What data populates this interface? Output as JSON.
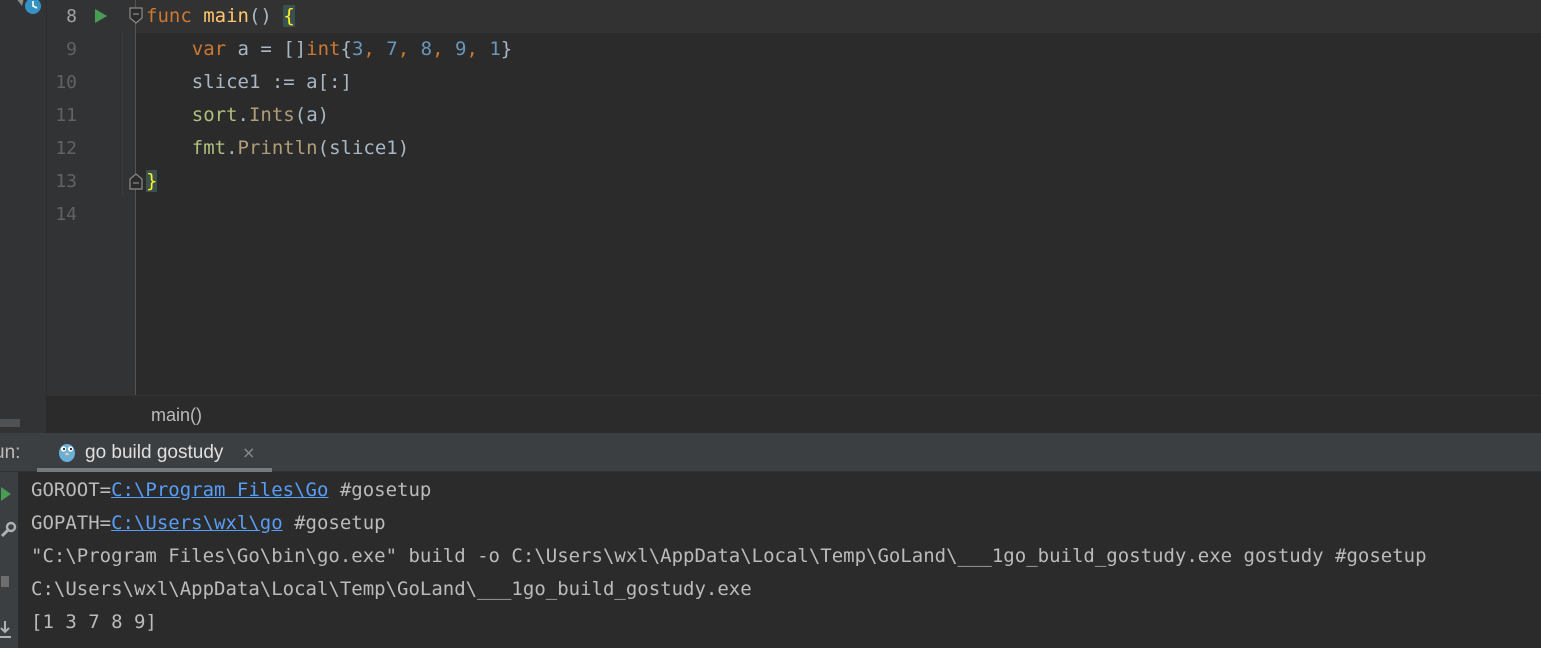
{
  "editor": {
    "line_numbers": [
      "8",
      "9",
      "10",
      "11",
      "12",
      "13",
      "14"
    ],
    "code": {
      "l8": {
        "kw_func": "func",
        "fn_name": "main",
        "parens": "() ",
        "brace": "{"
      },
      "l9": {
        "kw_var": "var",
        "assign": " a = []",
        "kw_int": "int",
        "open": "{",
        "n1": "3",
        "c1": ", ",
        "n2": "7",
        "c2": ", ",
        "n3": "8",
        "c3": ", ",
        "n4": "9",
        "c4": ", ",
        "n5": "1",
        "close": "}"
      },
      "l10": {
        "text": "slice1 := a[:]"
      },
      "l11": {
        "pkg": "sort",
        "dot": ".",
        "call": "Ints",
        "args": "(a)"
      },
      "l12": {
        "pkg": "fmt",
        "dot": ".",
        "call": "Println",
        "args": "(slice1)"
      },
      "l13": {
        "brace": "}"
      }
    },
    "breadcrumb": "main()"
  },
  "run_panel": {
    "label": "un:",
    "tab_label": "go build gostudy",
    "tab_close": "×",
    "console": {
      "l1": {
        "prefix": "GOROOT=",
        "link": "C:\\Program Files\\Go",
        "suffix": " #gosetup"
      },
      "l2": {
        "prefix": "GOPATH=",
        "link": "C:\\Users\\wxl\\go",
        "suffix": " #gosetup"
      },
      "l3": "\"C:\\Program Files\\Go\\bin\\go.exe\" build -o C:\\Users\\wxl\\AppData\\Local\\Temp\\GoLand\\___1go_build_gostudy.exe gostudy #gosetup",
      "l4": "C:\\Users\\wxl\\AppData\\Local\\Temp\\GoLand\\___1go_build_gostudy.exe",
      "l5": "[1 3 7 8 9]"
    }
  },
  "icons": [
    "tool-clock-icon",
    "run-gutter-icon",
    "fold-icon",
    "gopher-icon",
    "rerun-icon",
    "wrench-icon",
    "stop-icon",
    "download-icon"
  ],
  "colors": {
    "editor_bg": "#2b2b2b",
    "keyword": "#cc7832",
    "function": "#ffc66d",
    "number": "#6897bb",
    "link": "#589df6",
    "run_green": "#499c54"
  }
}
